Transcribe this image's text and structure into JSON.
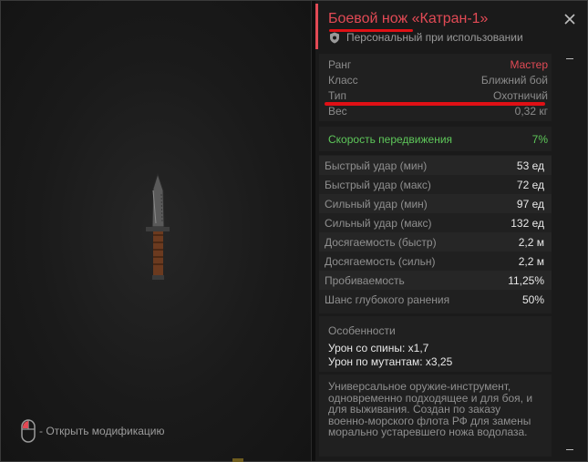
{
  "item": {
    "title": "Боевой нож «Катран-1»",
    "binding": "Персональный при использовании"
  },
  "props": [
    {
      "label": "Ранг",
      "value": "Мастер",
      "color": "#e24a55"
    },
    {
      "label": "Класс",
      "value": "Ближний бой"
    },
    {
      "label": "Тип",
      "value": "Охотничий"
    },
    {
      "label": "Вес",
      "value": "0,32 кг"
    }
  ],
  "speed": {
    "label": "Скорость передвижения",
    "value": "7%",
    "color": "#5ec85a"
  },
  "stats": [
    {
      "label": "Быстрый удар (мин)",
      "value": "53 ед"
    },
    {
      "label": "Быстрый удар (макс)",
      "value": "72 ед"
    },
    {
      "label": "Сильный удар (мин)",
      "value": "97 ед"
    },
    {
      "label": "Сильный удар (макс)",
      "value": "132 ед"
    },
    {
      "label": "Досягаемость (быстр)",
      "value": "2,2 м"
    },
    {
      "label": "Досягаемость (сильн)",
      "value": "2,2 м"
    },
    {
      "label": "Пробиваемость",
      "value": "11,25%"
    },
    {
      "label": "Шанс глубокого ранения",
      "value": "50%"
    }
  ],
  "features": {
    "heading": "Особенности",
    "items": [
      "Урон со спины: x1,7",
      "Урон по мутантам: x3,25"
    ]
  },
  "description": "Универсальное оружие-инструмент, одновременно подходящее и для боя, и для выживания. Создан по заказу военно-морского флота РФ для замены морально устаревшего ножа водолаза.",
  "hint": "- Открыть модификацию",
  "icons": {
    "close": "close-icon",
    "shield": "shield-icon",
    "mouse": "mouse-icon"
  }
}
